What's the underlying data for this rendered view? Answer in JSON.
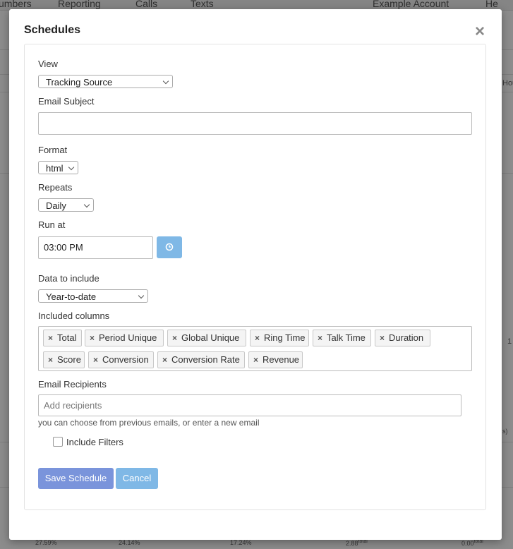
{
  "background": {
    "nav": [
      "umbers",
      "Reporting",
      "Calls",
      "Texts",
      "Example Account",
      "He"
    ],
    "footer_stats": [
      "27.59%",
      "24.14%",
      "17.24%",
      "2.88",
      "total",
      "0.00",
      "total"
    ],
    "edge_fragments": [
      "Hou",
      "1",
      "s)"
    ]
  },
  "modal": {
    "title": "Schedules",
    "close_symbol": "×",
    "view": {
      "label": "View",
      "selected": "Tracking Source"
    },
    "email_subject": {
      "label": "Email Subject",
      "value": ""
    },
    "format": {
      "label": "Format",
      "selected": "html"
    },
    "repeats": {
      "label": "Repeats",
      "selected": "Daily"
    },
    "run_at": {
      "label": "Run at",
      "value": "03:00 PM",
      "button_icon": "clock-icon"
    },
    "data_to_include": {
      "label": "Data to include",
      "selected": "Year-to-date"
    },
    "included_columns": {
      "label": "Included columns",
      "remove_symbol": "×",
      "tags": [
        "Total",
        "Period Unique",
        "Global Unique",
        "Ring Time",
        "Talk Time",
        "Duration",
        "Score",
        "Conversion",
        "Conversion Rate",
        "Revenue"
      ]
    },
    "email_recipients": {
      "label": "Email Recipients",
      "placeholder": "Add recipients",
      "help": "you can choose from previous emails, or enter a new email"
    },
    "include_filters": {
      "label": "Include Filters",
      "checked": false
    },
    "buttons": {
      "save": "Save Schedule",
      "cancel": "Cancel"
    },
    "colors": {
      "primary": "#7a94db",
      "info": "#7fb8e6"
    }
  }
}
